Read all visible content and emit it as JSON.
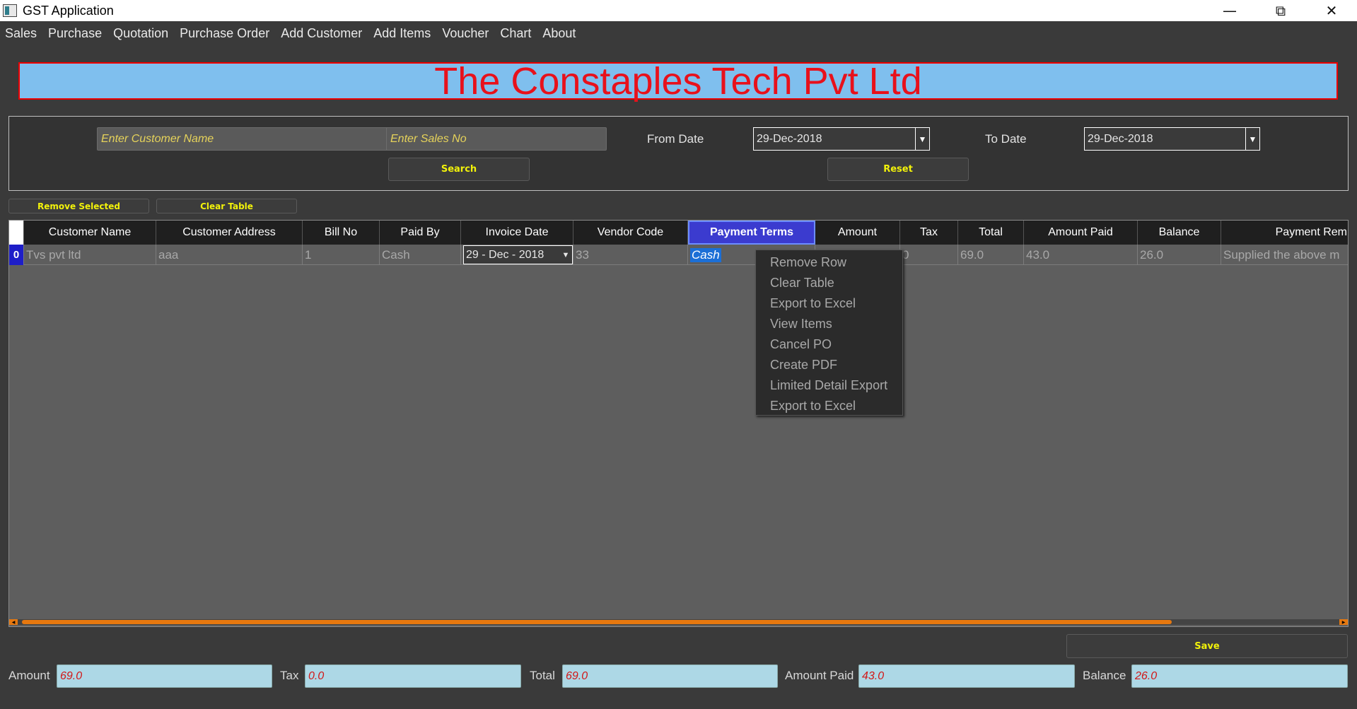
{
  "window": {
    "title": "GST Application",
    "controls": {
      "minimize": "—",
      "maximize": "⧉",
      "close": "✕"
    }
  },
  "menu": [
    "Sales",
    "Purchase",
    "Quotation",
    "Purchase Order",
    "Add Customer",
    "Add Items",
    "Voucher",
    "Chart",
    "About"
  ],
  "banner": {
    "company_name": "The Constaples Tech Pvt Ltd"
  },
  "search": {
    "customer_placeholder": "Enter Customer Name",
    "sales_no_placeholder": "Enter Sales No",
    "from_label": "From Date",
    "from_value": "29-Dec-2018",
    "to_label": "To Date",
    "to_value": "29-Dec-2018",
    "search_label": "Search",
    "reset_label": "Reset"
  },
  "actions": {
    "remove_selected": "Remove Selected",
    "clear_table": "Clear Table"
  },
  "table": {
    "columns": [
      "Customer Name",
      "Customer Address",
      "Bill No",
      "Paid By",
      "Invoice Date",
      "Vendor Code",
      "Payment Terms",
      "Amount",
      "Tax",
      "Total",
      "Amount Paid",
      "Balance",
      "Payment Rem"
    ],
    "rows": [
      {
        "index": "0",
        "customer_name": "Tvs pvt ltd",
        "customer_address": "aaa",
        "bill_no": "1",
        "paid_by": "Cash",
        "invoice_date": "29 - Dec - 2018",
        "vendor_code": "33",
        "payment_terms": "Cash",
        "amount": "",
        "tax": "0",
        "total": "69.0",
        "amount_paid": "43.0",
        "balance": "26.0",
        "payment_remarks": "Supplied the above m"
      }
    ]
  },
  "context_menu": [
    "Remove Row",
    "Clear Table",
    "Export to Excel",
    "View Items",
    "Cancel PO",
    "Create PDF",
    "Limited Detail Export",
    "Export to Excel"
  ],
  "save_label": "Save",
  "footer": {
    "amount_label": "Amount",
    "amount_value": "69.0",
    "tax_label": "Tax",
    "tax_value": "0.0",
    "total_label": "Total",
    "total_value": "69.0",
    "amount_paid_label": "Amount Paid",
    "amount_paid_value": "43.0",
    "balance_label": "Balance",
    "balance_value": "26.0"
  },
  "colors": {
    "banner_bg": "#7fbfee",
    "banner_text": "#e8111b",
    "button_text": "#f2f20a",
    "active_header": "#3b3bcf",
    "scroll_accent": "#e6780f"
  }
}
